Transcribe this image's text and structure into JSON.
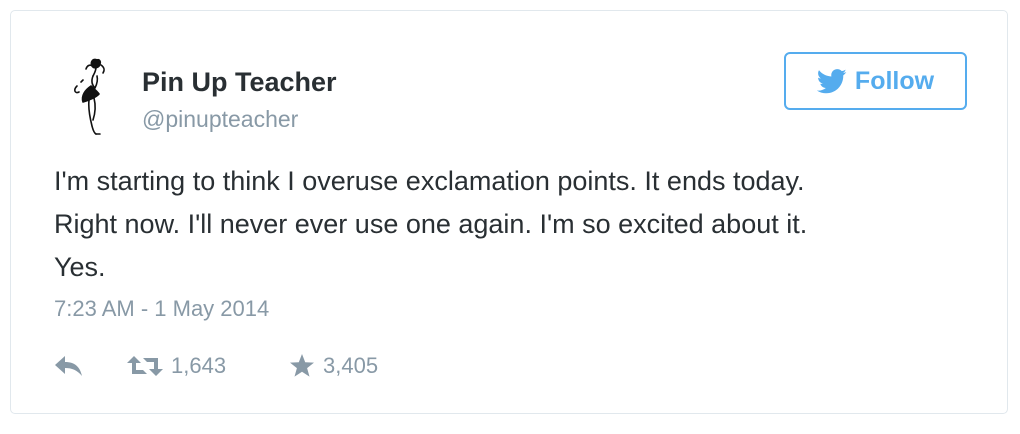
{
  "author": {
    "name": "Pin Up Teacher",
    "handle": "@pinupteacher",
    "avatar_icon": "pinup-girl-sketch-icon"
  },
  "follow_button": {
    "label": "Follow",
    "icon": "twitter-bird-icon"
  },
  "tweet": {
    "lines": [
      "I'm starting to think I overuse exclamation points. It ends today.",
      "Right now. I'll never ever use one again. I'm so excited about it.",
      "Yes."
    ],
    "timestamp": "7:23 AM - 1 May 2014"
  },
  "actions": {
    "reply_icon": "reply-icon",
    "retweet_icon": "retweet-icon",
    "retweet_count": "1,643",
    "favorite_icon": "star-icon",
    "favorite_count": "3,405"
  },
  "colors": {
    "accent": "#55acee",
    "muted": "#8899a6",
    "text": "#292f33",
    "border": "#e1e8ed"
  }
}
